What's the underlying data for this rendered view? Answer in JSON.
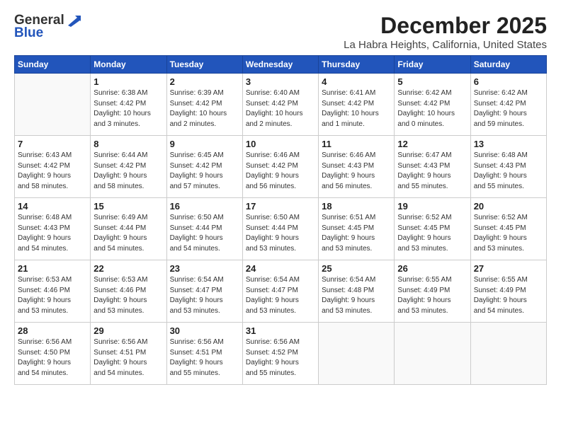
{
  "header": {
    "logo_general": "General",
    "logo_blue": "Blue",
    "title": "December 2025",
    "subtitle": "La Habra Heights, California, United States"
  },
  "weekdays": [
    "Sunday",
    "Monday",
    "Tuesday",
    "Wednesday",
    "Thursday",
    "Friday",
    "Saturday"
  ],
  "weeks": [
    [
      {
        "day": "",
        "info": ""
      },
      {
        "day": "1",
        "info": "Sunrise: 6:38 AM\nSunset: 4:42 PM\nDaylight: 10 hours\nand 3 minutes."
      },
      {
        "day": "2",
        "info": "Sunrise: 6:39 AM\nSunset: 4:42 PM\nDaylight: 10 hours\nand 2 minutes."
      },
      {
        "day": "3",
        "info": "Sunrise: 6:40 AM\nSunset: 4:42 PM\nDaylight: 10 hours\nand 2 minutes."
      },
      {
        "day": "4",
        "info": "Sunrise: 6:41 AM\nSunset: 4:42 PM\nDaylight: 10 hours\nand 1 minute."
      },
      {
        "day": "5",
        "info": "Sunrise: 6:42 AM\nSunset: 4:42 PM\nDaylight: 10 hours\nand 0 minutes."
      },
      {
        "day": "6",
        "info": "Sunrise: 6:42 AM\nSunset: 4:42 PM\nDaylight: 9 hours\nand 59 minutes."
      }
    ],
    [
      {
        "day": "7",
        "info": "Sunrise: 6:43 AM\nSunset: 4:42 PM\nDaylight: 9 hours\nand 58 minutes."
      },
      {
        "day": "8",
        "info": "Sunrise: 6:44 AM\nSunset: 4:42 PM\nDaylight: 9 hours\nand 58 minutes."
      },
      {
        "day": "9",
        "info": "Sunrise: 6:45 AM\nSunset: 4:42 PM\nDaylight: 9 hours\nand 57 minutes."
      },
      {
        "day": "10",
        "info": "Sunrise: 6:46 AM\nSunset: 4:42 PM\nDaylight: 9 hours\nand 56 minutes."
      },
      {
        "day": "11",
        "info": "Sunrise: 6:46 AM\nSunset: 4:43 PM\nDaylight: 9 hours\nand 56 minutes."
      },
      {
        "day": "12",
        "info": "Sunrise: 6:47 AM\nSunset: 4:43 PM\nDaylight: 9 hours\nand 55 minutes."
      },
      {
        "day": "13",
        "info": "Sunrise: 6:48 AM\nSunset: 4:43 PM\nDaylight: 9 hours\nand 55 minutes."
      }
    ],
    [
      {
        "day": "14",
        "info": "Sunrise: 6:48 AM\nSunset: 4:43 PM\nDaylight: 9 hours\nand 54 minutes."
      },
      {
        "day": "15",
        "info": "Sunrise: 6:49 AM\nSunset: 4:44 PM\nDaylight: 9 hours\nand 54 minutes."
      },
      {
        "day": "16",
        "info": "Sunrise: 6:50 AM\nSunset: 4:44 PM\nDaylight: 9 hours\nand 54 minutes."
      },
      {
        "day": "17",
        "info": "Sunrise: 6:50 AM\nSunset: 4:44 PM\nDaylight: 9 hours\nand 53 minutes."
      },
      {
        "day": "18",
        "info": "Sunrise: 6:51 AM\nSunset: 4:45 PM\nDaylight: 9 hours\nand 53 minutes."
      },
      {
        "day": "19",
        "info": "Sunrise: 6:52 AM\nSunset: 4:45 PM\nDaylight: 9 hours\nand 53 minutes."
      },
      {
        "day": "20",
        "info": "Sunrise: 6:52 AM\nSunset: 4:45 PM\nDaylight: 9 hours\nand 53 minutes."
      }
    ],
    [
      {
        "day": "21",
        "info": "Sunrise: 6:53 AM\nSunset: 4:46 PM\nDaylight: 9 hours\nand 53 minutes."
      },
      {
        "day": "22",
        "info": "Sunrise: 6:53 AM\nSunset: 4:46 PM\nDaylight: 9 hours\nand 53 minutes."
      },
      {
        "day": "23",
        "info": "Sunrise: 6:54 AM\nSunset: 4:47 PM\nDaylight: 9 hours\nand 53 minutes."
      },
      {
        "day": "24",
        "info": "Sunrise: 6:54 AM\nSunset: 4:47 PM\nDaylight: 9 hours\nand 53 minutes."
      },
      {
        "day": "25",
        "info": "Sunrise: 6:54 AM\nSunset: 4:48 PM\nDaylight: 9 hours\nand 53 minutes."
      },
      {
        "day": "26",
        "info": "Sunrise: 6:55 AM\nSunset: 4:49 PM\nDaylight: 9 hours\nand 53 minutes."
      },
      {
        "day": "27",
        "info": "Sunrise: 6:55 AM\nSunset: 4:49 PM\nDaylight: 9 hours\nand 54 minutes."
      }
    ],
    [
      {
        "day": "28",
        "info": "Sunrise: 6:56 AM\nSunset: 4:50 PM\nDaylight: 9 hours\nand 54 minutes."
      },
      {
        "day": "29",
        "info": "Sunrise: 6:56 AM\nSunset: 4:51 PM\nDaylight: 9 hours\nand 54 minutes."
      },
      {
        "day": "30",
        "info": "Sunrise: 6:56 AM\nSunset: 4:51 PM\nDaylight: 9 hours\nand 55 minutes."
      },
      {
        "day": "31",
        "info": "Sunrise: 6:56 AM\nSunset: 4:52 PM\nDaylight: 9 hours\nand 55 minutes."
      },
      {
        "day": "",
        "info": ""
      },
      {
        "day": "",
        "info": ""
      },
      {
        "day": "",
        "info": ""
      }
    ]
  ]
}
